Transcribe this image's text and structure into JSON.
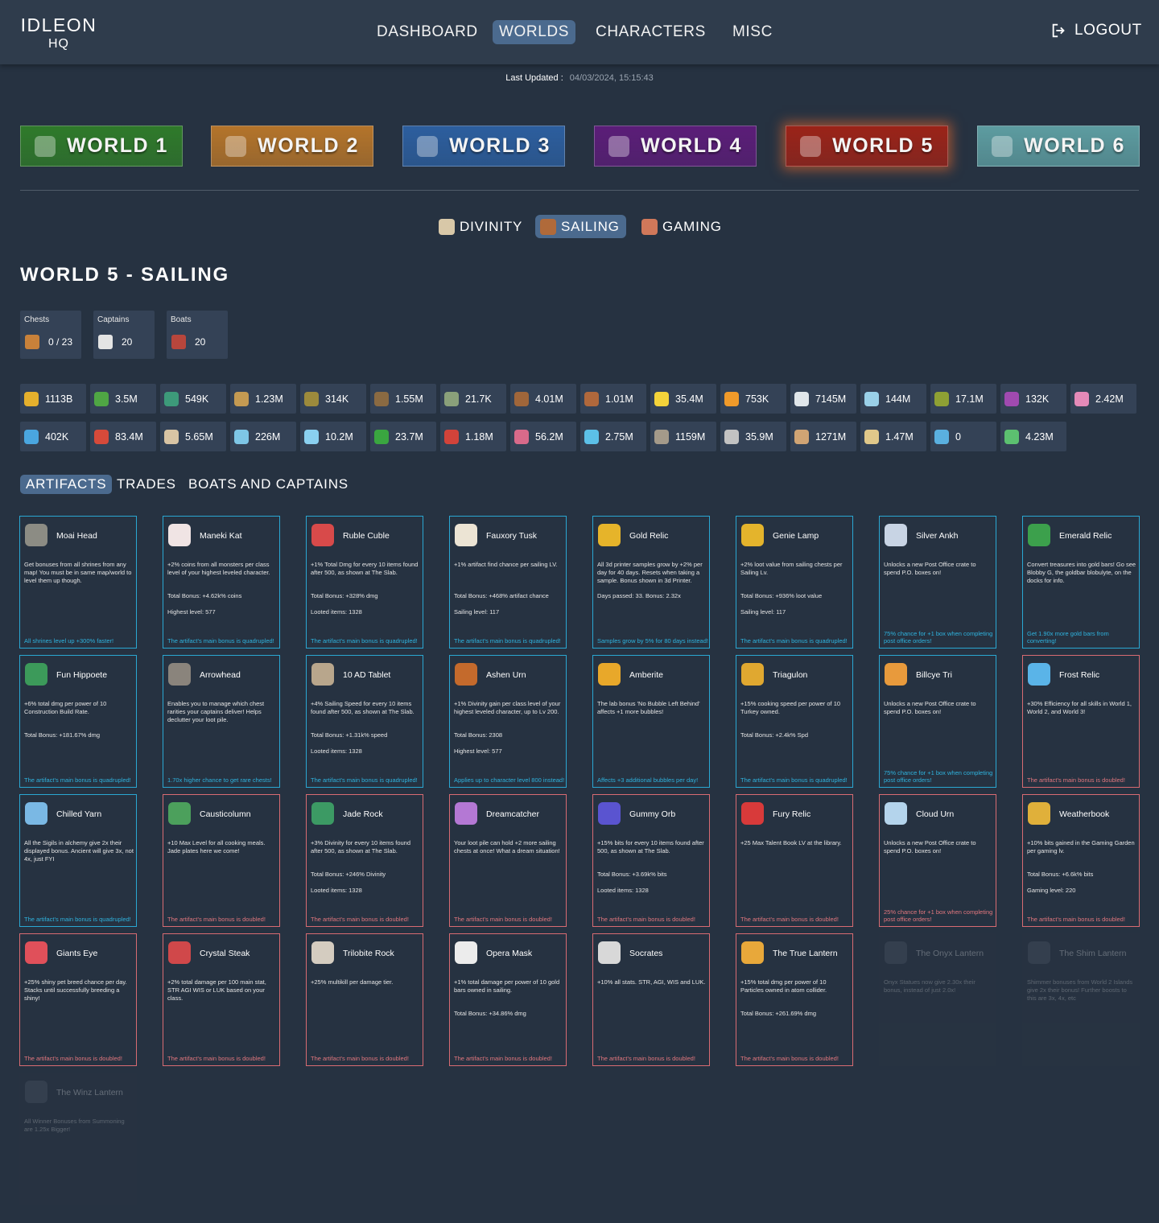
{
  "header": {
    "logo_line1": "IDLEON",
    "logo_line2": "HQ",
    "nav": [
      "DASHBOARD",
      "WORLDS",
      "CHARACTERS",
      "MISC"
    ],
    "active_nav": "WORLDS",
    "logout": "LOGOUT"
  },
  "last_updated": {
    "label": "Last Updated :",
    "value": "04/03/2024, 15:15:43"
  },
  "worlds": [
    "WORLD 1",
    "WORLD 2",
    "WORLD 3",
    "WORLD 4",
    "WORLD 5",
    "WORLD 6"
  ],
  "world_colors": [
    "#2f7a2a",
    "#b4742a",
    "#2c5e9e",
    "#5b1d78",
    "#9b2318",
    "#5d9ca0"
  ],
  "sub_tabs": [
    "DIVINITY",
    "SAILING",
    "GAMING"
  ],
  "page_title": "WORLD 5 - SAILING",
  "stats": [
    {
      "label": "Chests",
      "value": "0 / 23",
      "icon": "chest-icon",
      "color": "#c8813a"
    },
    {
      "label": "Captains",
      "value": "20",
      "icon": "captain-icon",
      "color": "#e4e4e4"
    },
    {
      "label": "Boats",
      "value": "20",
      "icon": "boat-icon",
      "color": "#b8463c"
    }
  ],
  "resources": [
    {
      "value": "1113B",
      "icon": "gold-bar-icon",
      "color": "#e5b02d"
    },
    {
      "value": "3.5M",
      "icon": "green-gem-icon",
      "color": "#4fa644"
    },
    {
      "value": "549K",
      "icon": "leaf-icon",
      "color": "#3d9a7a"
    },
    {
      "value": "1.23M",
      "icon": "idol-icon",
      "color": "#c49a52"
    },
    {
      "value": "314K",
      "icon": "palm-icon",
      "color": "#9c8a3c"
    },
    {
      "value": "1.55M",
      "icon": "coconut-icon",
      "color": "#8a6a42"
    },
    {
      "value": "21.7K",
      "icon": "rock-icon",
      "color": "#8aa07a"
    },
    {
      "value": "4.01M",
      "icon": "cone-icon",
      "color": "#a0663a"
    },
    {
      "value": "1.01M",
      "icon": "pile-icon",
      "color": "#b0683c"
    },
    {
      "value": "35.4M",
      "icon": "lightning-icon",
      "color": "#f4d33a"
    },
    {
      "value": "753K",
      "icon": "sparkle-icon",
      "color": "#f09a2a"
    },
    {
      "value": "7145M",
      "icon": "snowman-icon",
      "color": "#e0e6ea"
    },
    {
      "value": "144M",
      "icon": "ice-figure-icon",
      "color": "#9ad0e8"
    },
    {
      "value": "17.1M",
      "icon": "goblet-icon",
      "color": "#8ea034"
    },
    {
      "value": "132K",
      "icon": "purple-pot-icon",
      "color": "#a04ab0"
    },
    {
      "value": "2.42M",
      "icon": "lollipop-icon",
      "color": "#e48ab8"
    },
    {
      "value": "402K",
      "icon": "ice-cone-icon",
      "color": "#4aa6e0"
    },
    {
      "value": "83.4M",
      "icon": "mushroom-icon",
      "color": "#d64a3a"
    },
    {
      "value": "5.65M",
      "icon": "bone-icon",
      "color": "#d8c4a4"
    },
    {
      "value": "226M",
      "icon": "cloud-icon",
      "color": "#7ec6e6"
    },
    {
      "value": "10.2M",
      "icon": "cloud-rain-icon",
      "color": "#8ad0f0"
    },
    {
      "value": "23.7M",
      "icon": "green-cube-icon",
      "color": "#3aa640"
    },
    {
      "value": "1.18M",
      "icon": "red-scroll-icon",
      "color": "#d2433a"
    },
    {
      "value": "56.2M",
      "icon": "drink-icon",
      "color": "#d86a8a"
    },
    {
      "value": "2.75M",
      "icon": "diamond-icon",
      "color": "#5cc0e8"
    },
    {
      "value": "1159M",
      "icon": "tombstone-icon",
      "color": "#a49a8a"
    },
    {
      "value": "35.9M",
      "icon": "skull-icon",
      "color": "#c2c2c2"
    },
    {
      "value": "1271M",
      "icon": "bottles-icon",
      "color": "#d0a474"
    },
    {
      "value": "1.47M",
      "icon": "music-note-icon",
      "color": "#e0c88a"
    },
    {
      "value": "0",
      "icon": "blue-rune-icon",
      "color": "#5ab0e0"
    },
    {
      "value": "4.23M",
      "icon": "green-rune-icon",
      "color": "#5cc070"
    }
  ],
  "content_tabs": [
    "ARTIFACTS",
    "TRADES",
    "BOATS AND CAPTAINS"
  ],
  "artifacts": [
    {
      "name": "Moai Head",
      "desc": "Get bonuses from all shrines from any map! You must be in same map/world to level them up though.",
      "t1": "",
      "t2": "",
      "bonus": "All shrines level up +300% faster!",
      "style": "blue",
      "icon": "moai-icon",
      "color": "#8c8c84"
    },
    {
      "name": "Maneki Kat",
      "desc": "+2% coins from all monsters per class level of your highest leveled character.",
      "t1": "Total Bonus: +4.62k% coins",
      "t2": "Highest level: 577",
      "bonus": "The artifact's main bonus is quadrupled!",
      "style": "blue",
      "icon": "cat-icon",
      "color": "#f0e4e4"
    },
    {
      "name": "Ruble Cuble",
      "desc": "+1% Total Dmg for every 10 items found after 500, as shown at The Slab.",
      "t1": "Total Bonus: +328% dmg",
      "t2": "Looted items: 1328",
      "bonus": "The artifact's main bonus is quadrupled!",
      "style": "blue",
      "icon": "cube-icon",
      "color": "#d84a4a"
    },
    {
      "name": "Fauxory Tusk",
      "desc": "+1% artifact find chance per sailing LV.",
      "t1": "Total Bonus: +468% artifact chance",
      "t2": "Sailing level: 117",
      "bonus": "The artifact's main bonus is quadrupled!",
      "style": "blue",
      "icon": "tusk-icon",
      "color": "#ece4d4"
    },
    {
      "name": "Gold Relic",
      "desc": "All 3d printer samples grow by +2% per day for 40 days. Resets when taking a sample. Bonus shown in 3d Printer.",
      "t1": "Days passed: 33. Bonus: 2.32x",
      "t2": "",
      "bonus": "Samples grow by 5% for 80 days instead!",
      "style": "blue",
      "icon": "gold-mask-icon",
      "color": "#e6b42a"
    },
    {
      "name": "Genie Lamp",
      "desc": "+2% loot value from sailing chests per Sailing Lv.",
      "t1": "Total Bonus: +936% loot value",
      "t2": "Sailing level: 117",
      "bonus": "The artifact's main bonus is quadrupled!",
      "style": "blue",
      "icon": "lamp-icon",
      "color": "#e4b42c"
    },
    {
      "name": "Silver Ankh",
      "desc": "Unlocks a new Post Office crate to spend P.O. boxes on!",
      "t1": "",
      "t2": "",
      "bonus": "75% chance for +1 box when completing post office orders!",
      "style": "blue",
      "icon": "ankh-icon",
      "color": "#c8d4e4"
    },
    {
      "name": "Emerald Relic",
      "desc": "Convert treasures into gold bars! Go see Blobby G, the goldbar blobulyte, on the docks for info.",
      "t1": "",
      "t2": "",
      "bonus": "Get 1.90x more gold bars from converting!",
      "style": "blue",
      "icon": "emerald-mask-icon",
      "color": "#3ca04c"
    },
    {
      "name": "Fun Hippoete",
      "desc": "+6% total dmg per power of 10 Construction Build Rate.",
      "t1": "Total Bonus: +181.67% dmg",
      "t2": "",
      "bonus": "The artifact's main bonus is quadrupled!",
      "style": "blue",
      "icon": "hippo-icon",
      "color": "#3c9a5a"
    },
    {
      "name": "Arrowhead",
      "desc": "Enables you to manage which chest rarities your captains deliver! Helps declutter your loot pile.",
      "t1": "",
      "t2": "",
      "bonus": "1.70x higher chance to get rare chests!",
      "style": "blue",
      "icon": "arrowhead-icon",
      "color": "#8a847c"
    },
    {
      "name": "10 AD Tablet",
      "desc": "+4% Sailing Speed for every 10 items found after 500, as shown at The Slab.",
      "t1": "Total Bonus: +1.31k% speed",
      "t2": "Looted items: 1328",
      "bonus": "The artifact's main bonus is quadrupled!",
      "style": "blue",
      "icon": "tablet-icon",
      "color": "#b8a68c"
    },
    {
      "name": "Ashen Urn",
      "desc": "+1% Divinity gain per class level of your highest leveled character, up to Lv 200.",
      "t1": "Total Bonus: 2308",
      "t2": "Highest level: 577",
      "bonus": "Applies up to character level 800 instead!",
      "style": "blue",
      "icon": "urn-icon",
      "color": "#c46a2c"
    },
    {
      "name": "Amberite",
      "desc": "The lab bonus 'No Bubble Left Behind' affects +1 more bubbles!",
      "t1": "",
      "t2": "",
      "bonus": "Affects +3 additional bubbles per day!",
      "style": "blue",
      "icon": "amber-icon",
      "color": "#e8a82a"
    },
    {
      "name": "Triagulon",
      "desc": "+15% cooking speed per power of 10 Turkey owned.",
      "t1": "Total Bonus: +2.4k% Spd",
      "t2": "",
      "bonus": "The artifact's main bonus is quadrupled!",
      "style": "blue",
      "icon": "triangle-icon",
      "color": "#e0a830"
    },
    {
      "name": "Billcye Tri",
      "desc": "Unlocks a new Post Office crate to spend P.O. boxes on!",
      "t1": "",
      "t2": "",
      "bonus": "75% chance for +1 box when completing post office orders!",
      "style": "blue",
      "icon": "pyramid-icon",
      "color": "#e89a3c"
    },
    {
      "name": "Frost Relic",
      "desc": "+30% Efficiency for all skills in World 1, World 2, and World 3!",
      "t1": "",
      "t2": "",
      "bonus": "The artifact's main bonus is doubled!",
      "style": "red",
      "icon": "frost-mask-icon",
      "color": "#5ab4e8"
    },
    {
      "name": "Chilled Yarn",
      "desc": "All the Sigils in alchemy give 2x their displayed bonus. Ancient will give 3x, not 4x, just FYI",
      "t1": "",
      "t2": "",
      "bonus": "The artifact's main bonus is quadrupled!",
      "style": "blue",
      "icon": "yarn-icon",
      "color": "#7ab8e4"
    },
    {
      "name": "Causticolumn",
      "desc": "+10 Max Level for all cooking meals. Jade plates here we come!",
      "t1": "",
      "t2": "",
      "bonus": "The artifact's main bonus is doubled!",
      "style": "red",
      "icon": "column-icon",
      "color": "#4ca05c"
    },
    {
      "name": "Jade Rock",
      "desc": "+3% Divinity for every 10 items found after 500, as shown at The Slab.",
      "t1": "Total Bonus: +246% Divinity",
      "t2": "Looted items: 1328",
      "bonus": "The artifact's main bonus is doubled!",
      "style": "red",
      "icon": "jade-icon",
      "color": "#3c9a64"
    },
    {
      "name": "Dreamcatcher",
      "desc": "Your loot pile can hold +2 more sailing chests at once! What a dream situation!",
      "t1": "",
      "t2": "",
      "bonus": "The artifact's main bonus is doubled!",
      "style": "red",
      "icon": "dreamcatcher-icon",
      "color": "#b478d4"
    },
    {
      "name": "Gummy Orb",
      "desc": "+15% bits for every 10 items found after 500, as shown at The Slab.",
      "t1": "Total Bonus: +3.69k% bits",
      "t2": "Looted items: 1328",
      "bonus": "The artifact's main bonus is doubled!",
      "style": "red",
      "icon": "orb-icon",
      "color": "#5a54d0"
    },
    {
      "name": "Fury Relic",
      "desc": "+25 Max Talent Book LV at the library.",
      "t1": "",
      "t2": "",
      "bonus": "The artifact's main bonus is doubled!",
      "style": "red",
      "icon": "fury-mask-icon",
      "color": "#d83a3a"
    },
    {
      "name": "Cloud Urn",
      "desc": "Unlocks a new Post Office crate to spend P.O. boxes on!",
      "t1": "",
      "t2": "",
      "bonus": "25% chance for +1 box when completing post office orders!",
      "style": "red",
      "icon": "cloud-urn-icon",
      "color": "#b4d4ec"
    },
    {
      "name": "Weatherbook",
      "desc": "+10% bits gained in the Gaming Garden per gaming lv.",
      "t1": "Total Bonus: +6.6k% bits",
      "t2": "Gaming level: 220",
      "bonus": "The artifact's main bonus is doubled!",
      "style": "red",
      "icon": "book-icon",
      "color": "#e0b03a"
    },
    {
      "name": "Giants Eye",
      "desc": "+25% shiny pet breed chance per day. Stacks until successfully breeding a shiny!",
      "t1": "",
      "t2": "",
      "bonus": "The artifact's main bonus is doubled!",
      "style": "red",
      "icon": "eye-icon",
      "color": "#e0505a"
    },
    {
      "name": "Crystal Steak",
      "desc": "+2% total damage per 100 main stat, STR AGI WIS or LUK based on your class.",
      "t1": "",
      "t2": "",
      "bonus": "The artifact's main bonus is doubled!",
      "style": "red",
      "icon": "steak-icon",
      "color": "#d0484a"
    },
    {
      "name": "Trilobite Rock",
      "desc": "+25% multikill per damage tier.",
      "t1": "",
      "t2": "",
      "bonus": "The artifact's main bonus is doubled!",
      "style": "red",
      "icon": "trilobite-icon",
      "color": "#d4ccc0"
    },
    {
      "name": "Opera Mask",
      "desc": "+1% total damage per power of 10 gold bars owned in sailing.",
      "t1": "Total Bonus: +34.86% dmg",
      "t2": "",
      "bonus": "The artifact's main bonus is doubled!",
      "style": "red",
      "icon": "opera-mask-icon",
      "color": "#ececec"
    },
    {
      "name": "Socrates",
      "desc": "+10% all stats. STR, AGI, WIS and LUK.",
      "t1": "",
      "t2": "",
      "bonus": "The artifact's main bonus is doubled!",
      "style": "red",
      "icon": "bust-icon",
      "color": "#d8d8d8"
    },
    {
      "name": "The True Lantern",
      "desc": "+15% total dmg per power of 10 Particles owned in atom collider.",
      "t1": "Total Bonus: +261.69% dmg",
      "t2": "",
      "bonus": "The artifact's main bonus is doubled!",
      "style": "red",
      "icon": "lantern-icon",
      "color": "#e8a83a"
    },
    {
      "name": "The Onyx Lantern",
      "desc": "Onyx Statues now give 2.30x their bonus, instead of just 2.0x!",
      "t1": "",
      "t2": "",
      "bonus": "",
      "style": "dim",
      "icon": "onyx-lantern-icon",
      "color": "#5a6272"
    },
    {
      "name": "The Shim Lantern",
      "desc": "Shimmer bonuses from World 2 Islands give 2x their bonus! Further boosts to this are 3x, 4x, etc",
      "t1": "",
      "t2": "",
      "bonus": "",
      "style": "dim",
      "icon": "shim-lantern-icon",
      "color": "#5a6272"
    },
    {
      "name": "The Winz Lantern",
      "desc": "All Winner Bonuses from Summoning are 1.25x Bigger!",
      "t1": "",
      "t2": "",
      "bonus": "",
      "style": "dim",
      "icon": "winz-lantern-icon",
      "color": "#5a6272"
    }
  ]
}
